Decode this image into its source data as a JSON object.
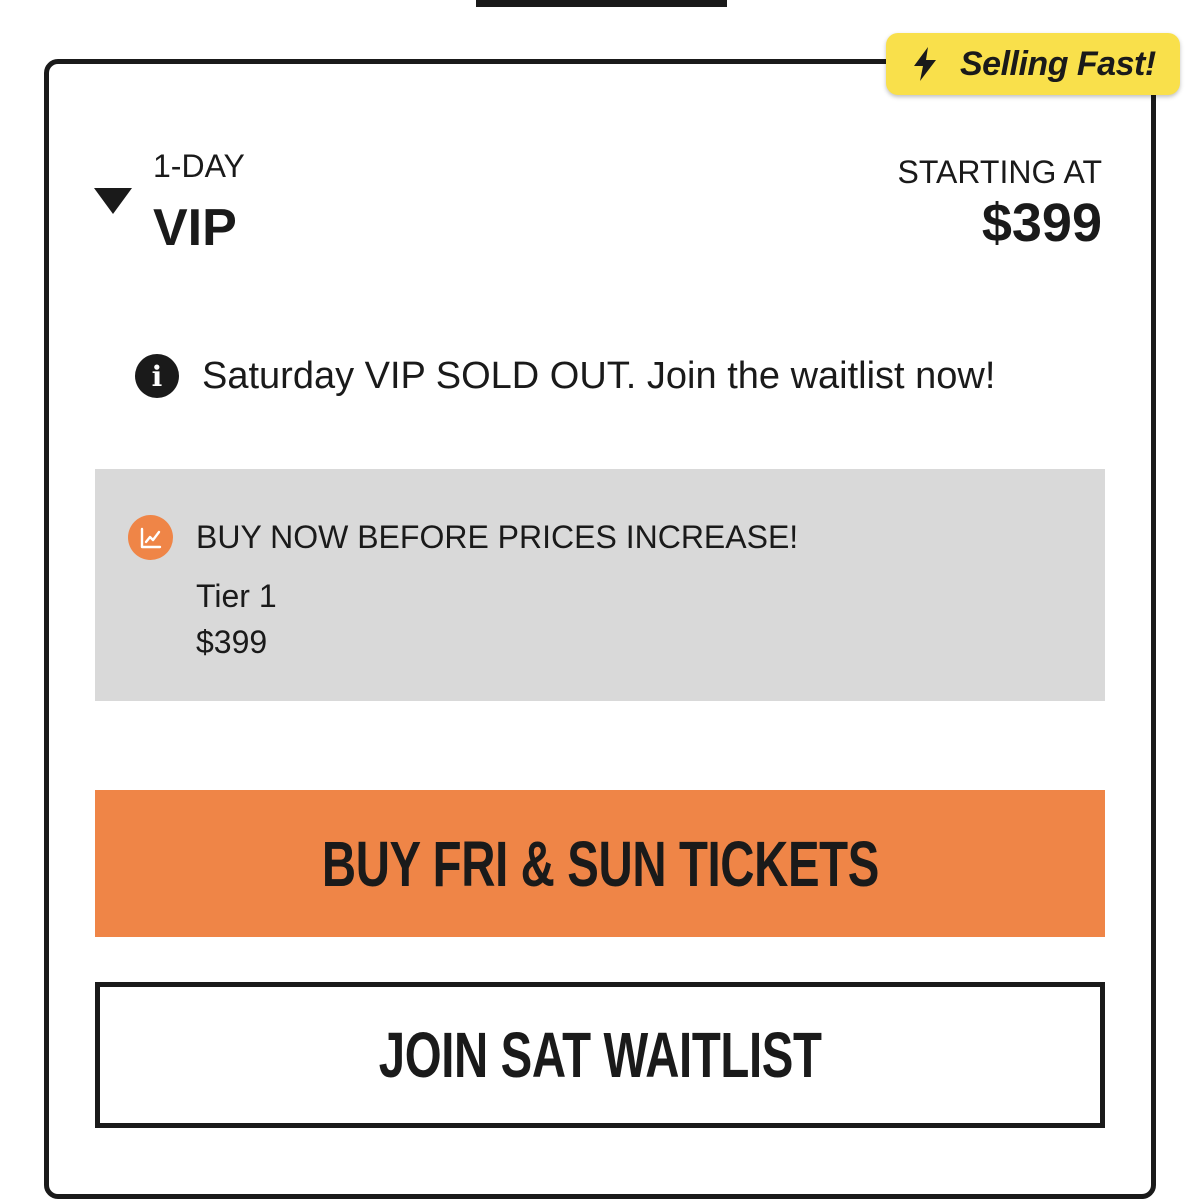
{
  "badge": {
    "icon": "lightning-bolt-icon",
    "label": "Selling Fast!",
    "color": "#f9e04b"
  },
  "ticket": {
    "expand_icon": "triangle-down-icon",
    "subtitle": "1-DAY",
    "title": "VIP",
    "starting_label": "STARTING AT",
    "starting_price": "$399"
  },
  "notice": {
    "icon": "info-icon",
    "text": "Saturday VIP SOLD OUT. Join the waitlist now!"
  },
  "pricing_panel": {
    "icon": "trending-up-icon",
    "heading": "BUY NOW BEFORE PRICES INCREASE!",
    "tier_name": "Tier 1",
    "tier_price": "$399",
    "background_color": "#d9d9d9"
  },
  "actions": {
    "buy_label": "BUY FRI & SUN TICKETS",
    "waitlist_label": "JOIN SAT WAITLIST",
    "accent_color": "#ef8547"
  }
}
